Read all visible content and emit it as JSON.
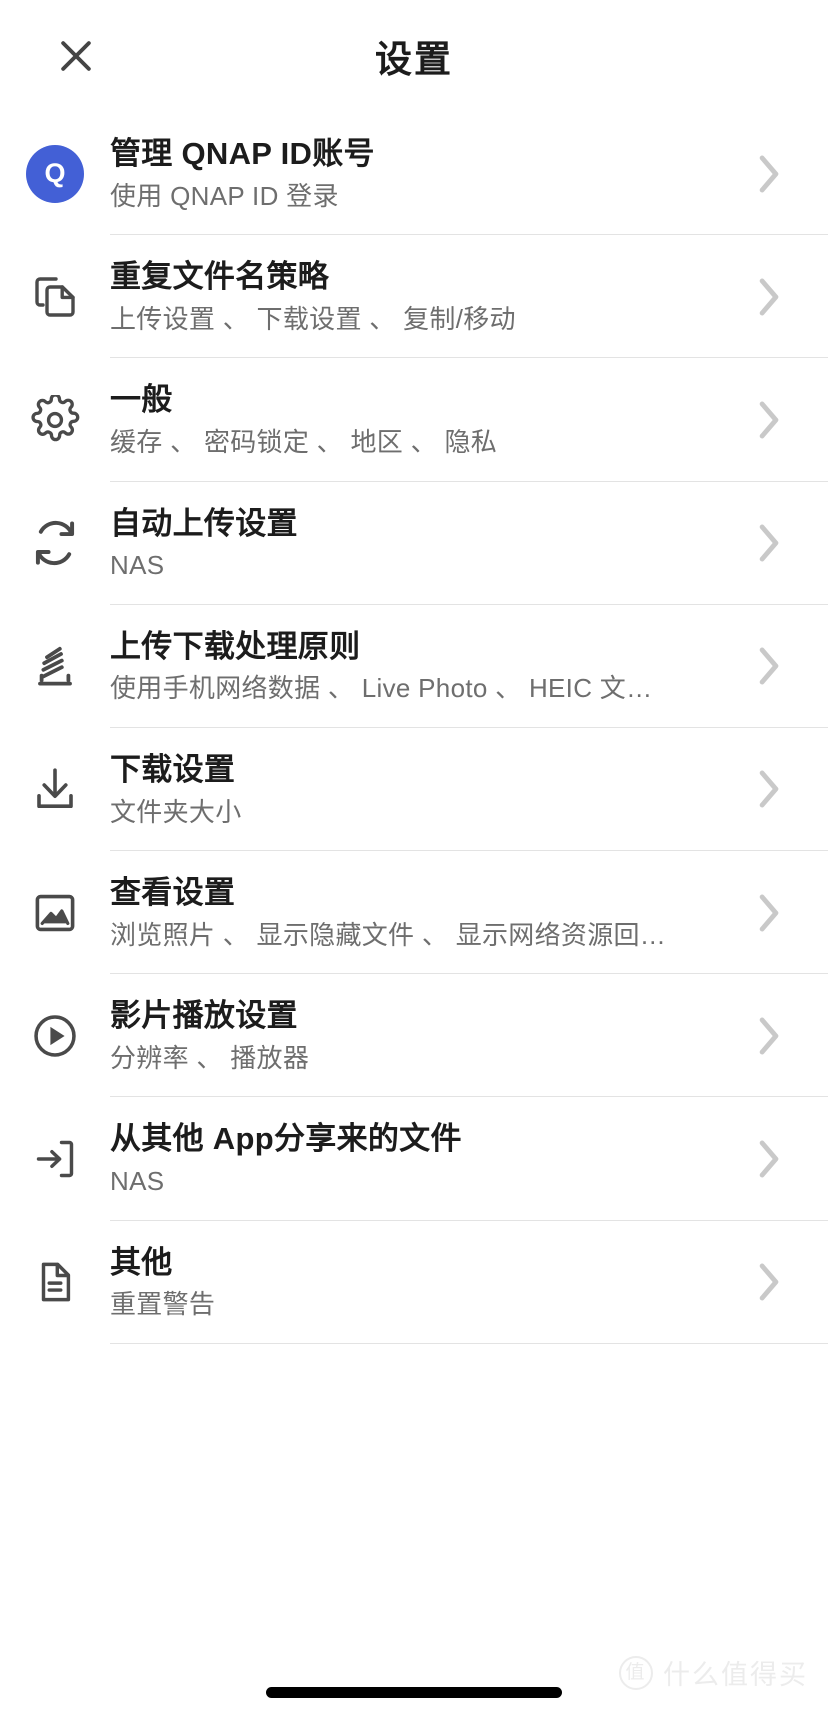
{
  "header": {
    "title": "设置",
    "close_icon": "close-icon"
  },
  "list": {
    "items": [
      {
        "icon": "qnap-avatar",
        "avatar_letter": "Q",
        "title": "管理 QNAP ID账号",
        "subtitle": "使用 QNAP ID 登录",
        "chevron": "chevron-right-icon"
      },
      {
        "icon": "copy-icon",
        "title": "重复文件名策略",
        "subtitle": "上传设置 、  下载设置 、  复制/移动",
        "chevron": "chevron-right-icon"
      },
      {
        "icon": "gear-icon",
        "title": "一般",
        "subtitle": "缓存 、  密码锁定 、  地区 、  隐私",
        "chevron": "chevron-right-icon"
      },
      {
        "icon": "sync-icon",
        "title": "自动上传设置",
        "subtitle": "NAS",
        "chevron": "chevron-right-icon"
      },
      {
        "icon": "upload-rules-icon",
        "title": "上传下载处理原则",
        "subtitle": "使用手机网络数据 、  Live Photo 、  HEIC 文…",
        "chevron": "chevron-right-icon"
      },
      {
        "icon": "download-icon",
        "title": "下载设置",
        "subtitle": "文件夹大小",
        "chevron": "chevron-right-icon"
      },
      {
        "icon": "image-icon",
        "title": "查看设置",
        "subtitle": "浏览照片 、  显示隐藏文件 、  显示网络资源回…",
        "chevron": "chevron-right-icon"
      },
      {
        "icon": "play-circle-icon",
        "title": "影片播放设置",
        "subtitle": "分辨率 、  播放器",
        "chevron": "chevron-right-icon"
      },
      {
        "icon": "share-in-icon",
        "title": "从其他 App分享来的文件",
        "subtitle": "NAS",
        "chevron": "chevron-right-icon"
      },
      {
        "icon": "document-icon",
        "title": "其他",
        "subtitle": "重置警告",
        "chevron": "chevron-right-icon"
      }
    ]
  },
  "watermark": {
    "badge": "值",
    "text": "什么值得买"
  },
  "colors": {
    "avatar_blue": "#4360d6",
    "title_text": "#1c1c1c",
    "subtitle_text": "#6e6e6e",
    "icon_gray": "#4a4a4a",
    "chevron_gray": "#c9c9c9",
    "divider": "#e3e3e3"
  }
}
